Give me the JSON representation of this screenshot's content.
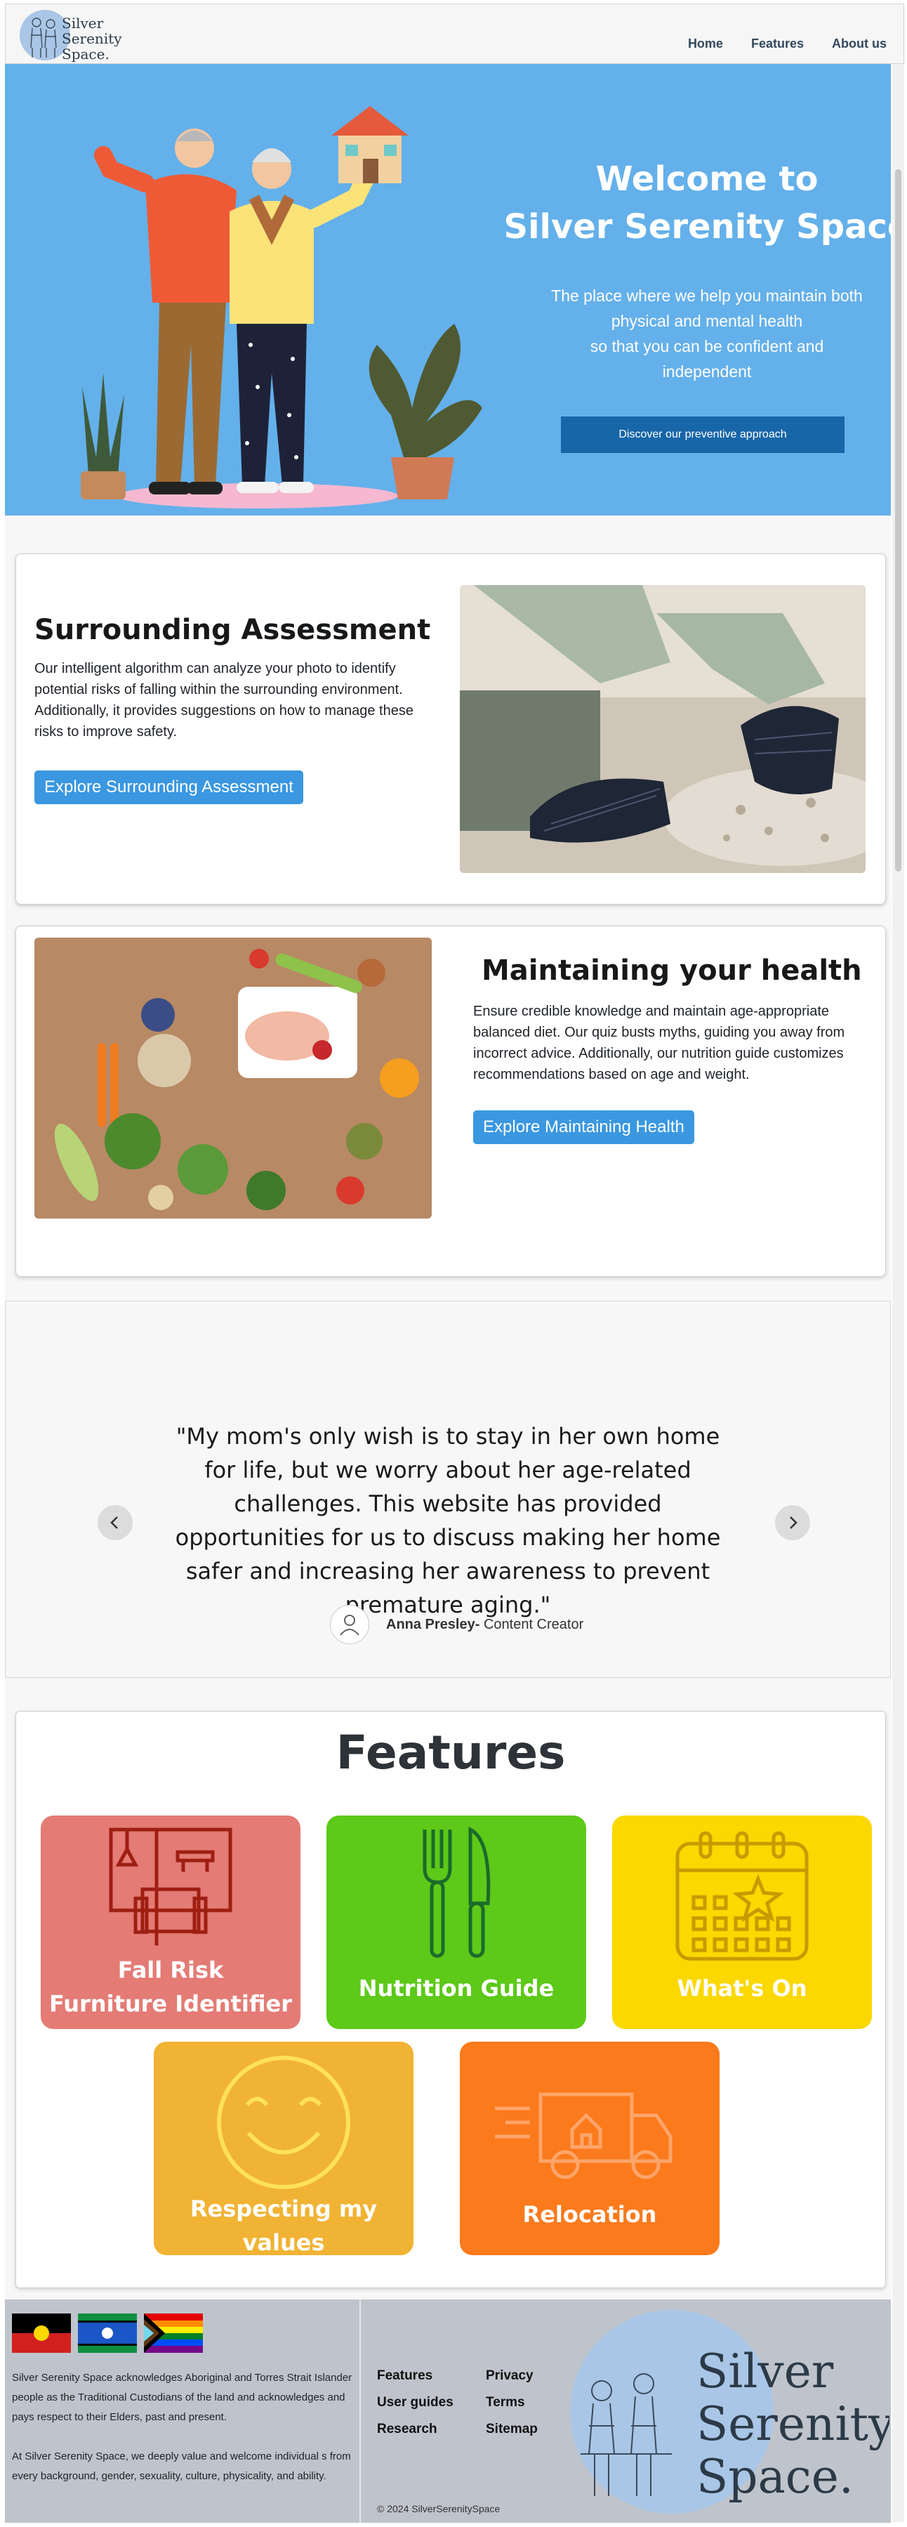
{
  "nav": {
    "logo_text": [
      "Silver",
      "Serenity",
      "Space."
    ],
    "links": [
      "Home",
      "Features",
      "About us"
    ]
  },
  "hero": {
    "title_line1": "Welcome to",
    "title_line2": "Silver Serenity Space",
    "subtitle_line1": "The place where we help you maintain both",
    "subtitle_line2": "physical and mental health",
    "subtitle_line3": "so that you can be confident and",
    "subtitle_line4": "independent",
    "button": "Discover our preventive approach"
  },
  "assessment": {
    "title": "Surrounding Assessment",
    "body": "Our intelligent algorithm can analyze your photo to identify potential risks of falling within the surrounding environment. Additionally, it provides suggestions on how to manage these risks to improve safety.",
    "button": "Explore Surrounding Assessment"
  },
  "health": {
    "title": "Maintaining your health",
    "body": "Ensure credible knowledge and maintain age-appropriate balanced diet. Our quiz busts myths, guiding you away from incorrect advice. Additionally, our nutrition guide customizes recommendations based on age and weight.",
    "button": "Explore Maintaining Health"
  },
  "testimonial": {
    "quote": "\"My mom's only wish is to stay in her own home for life, but we worry about her age-related challenges. This website has provided opportunities for us to discuss making her home safer and increasing her awareness to prevent premature aging.\"",
    "author": "Anna Presley-",
    "role": " Content Creator"
  },
  "features": {
    "title": "Features",
    "tiles": [
      {
        "label_line1": "Fall Risk",
        "label_line2": "Furniture Identifier",
        "color": "#e47b75",
        "icon": "furniture-icon"
      },
      {
        "label_line1": "Nutrition Guide",
        "label_line2": "",
        "color": "#5dc918",
        "icon": "fork-knife-icon"
      },
      {
        "label_line1": "What's On",
        "label_line2": "",
        "color": "#fbd800",
        "icon": "calendar-star-icon"
      },
      {
        "label_line1": "Respecting my values",
        "label_line2": "",
        "color": "#f1b334",
        "icon": "smile-icon"
      },
      {
        "label_line1": "Relocation",
        "label_line2": "",
        "color": "#fb7a1c",
        "icon": "moving-truck-icon"
      }
    ]
  },
  "footer": {
    "ack_p1": "Silver Serenity Space acknowledges Aboriginal and Torres Strait Islander people as the Traditional Custodians of the land  and acknowledges and pays respect to their Elders, past and present.",
    "ack_p2": "At Silver Serenity Space, we deeply value and welcome individual s from every background, gender, sexuality, culture, physicality, and ability.",
    "links": [
      "Features",
      "Privacy",
      "User guides",
      "Terms",
      "Research",
      "Sitemap"
    ],
    "copyright": "© 2024 SilverSerenitySpace",
    "logo_text": [
      "Silver",
      "Serenity",
      "Space."
    ]
  }
}
